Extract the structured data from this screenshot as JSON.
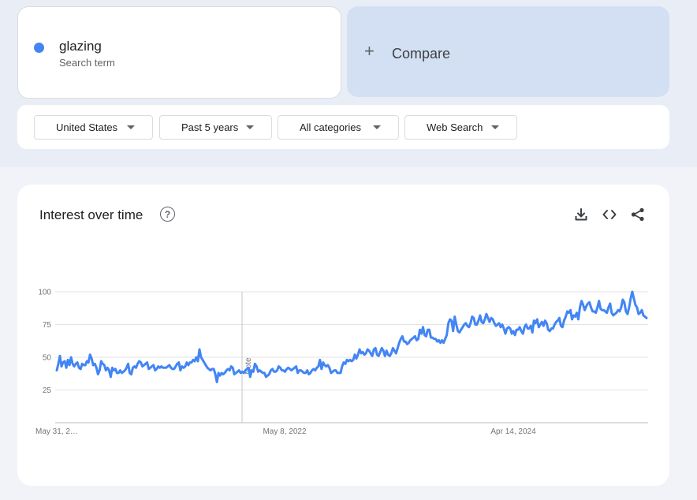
{
  "search_term": {
    "name": "glazing",
    "sublabel": "Search term",
    "color": "#4285f4"
  },
  "compare": {
    "plus": "+",
    "label": "Compare"
  },
  "filters": [
    {
      "label": "United States"
    },
    {
      "label": "Past 5 years"
    },
    {
      "label": "All categories"
    },
    {
      "label": "Web Search"
    }
  ],
  "panel": {
    "title": "Interest over time",
    "help_icon": "?",
    "icons": [
      "download-icon",
      "embed-icon",
      "share-icon"
    ]
  },
  "chart_data": {
    "type": "line",
    "title": "",
    "xlabel": "",
    "ylabel": "",
    "ylim": [
      0,
      100
    ],
    "yticks": [
      25,
      50,
      75,
      100
    ],
    "xtick_labels": [
      "May 31, 2…",
      "May 8, 2022",
      "Apr 14, 2024"
    ],
    "note": "Note",
    "grid": true,
    "series": [
      {
        "color": "#4285f4",
        "values": [
          40,
          45,
          51,
          43,
          46,
          47,
          42,
          48,
          44,
          50,
          45,
          43,
          45,
          46,
          42,
          41,
          45,
          44,
          44,
          47,
          46,
          52,
          49,
          44,
          45,
          42,
          37,
          40,
          47,
          45,
          44,
          40,
          42,
          40,
          35,
          42,
          40,
          41,
          38,
          38,
          40,
          38,
          39,
          40,
          42,
          45,
          38,
          37,
          42,
          43,
          42,
          45,
          47,
          46,
          43,
          44,
          45,
          46,
          41,
          42,
          43,
          44,
          40,
          41,
          43,
          42,
          43,
          42,
          42,
          42,
          43,
          44,
          42,
          41,
          41,
          43,
          45,
          46,
          40,
          43,
          42,
          43,
          46,
          44,
          46,
          46,
          48,
          47,
          50,
          47,
          56,
          50,
          48,
          46,
          44,
          42,
          41,
          40,
          41,
          41,
          37,
          31,
          38,
          36,
          38,
          37,
          38,
          40,
          41,
          40,
          43,
          42,
          37,
          38,
          39,
          40,
          38,
          39,
          38,
          40,
          41,
          42,
          35,
          40,
          39,
          45,
          43,
          39,
          40,
          39,
          38,
          38,
          35,
          36,
          37,
          40,
          41,
          39,
          39,
          40,
          43,
          42,
          40,
          40,
          39,
          41,
          42,
          41,
          40,
          41,
          42,
          43,
          38,
          40,
          40,
          39,
          38,
          38,
          40,
          37,
          38,
          40,
          41,
          40,
          42,
          43,
          48,
          41,
          46,
          44,
          43,
          44,
          42,
          38,
          39,
          40,
          40,
          38,
          38,
          38,
          43,
          46,
          45,
          48,
          47,
          48,
          47,
          48,
          52,
          49,
          52,
          56,
          53,
          54,
          52,
          53,
          56,
          55,
          53,
          51,
          56,
          57,
          52,
          51,
          54,
          57,
          55,
          51,
          55,
          52,
          51,
          53,
          57,
          55,
          53,
          57,
          61,
          64,
          66,
          62,
          62,
          60,
          61,
          63,
          64,
          65,
          66,
          63,
          64,
          71,
          68,
          73,
          67,
          66,
          71,
          71,
          65,
          65,
          64,
          64,
          62,
          63,
          61,
          63,
          61,
          64,
          67,
          76,
          79,
          78,
          70,
          81,
          75,
          70,
          69,
          71,
          73,
          75,
          76,
          74,
          73,
          76,
          81,
          80,
          75,
          75,
          78,
          82,
          77,
          76,
          79,
          83,
          80,
          77,
          80,
          79,
          76,
          74,
          75,
          76,
          73,
          75,
          72,
          68,
          72,
          73,
          72,
          68,
          70,
          67,
          71,
          71,
          73,
          70,
          68,
          73,
          75,
          72,
          72,
          74,
          69,
          78,
          76,
          79,
          73,
          75,
          77,
          74,
          78,
          76,
          71,
          70,
          72,
          72,
          75,
          77,
          78,
          80,
          74,
          73,
          78,
          81,
          85,
          84,
          86,
          79,
          82,
          81,
          84,
          79,
          88,
          93,
          90,
          86,
          89,
          91,
          92,
          88,
          85,
          85,
          84,
          88,
          93,
          87,
          86,
          86,
          85,
          84,
          88,
          91,
          84,
          82,
          83,
          84,
          86,
          85,
          88,
          94,
          92,
          85,
          83,
          88,
          95,
          100,
          95,
          90,
          88,
          83,
          84,
          86,
          82,
          81,
          80
        ]
      }
    ]
  }
}
